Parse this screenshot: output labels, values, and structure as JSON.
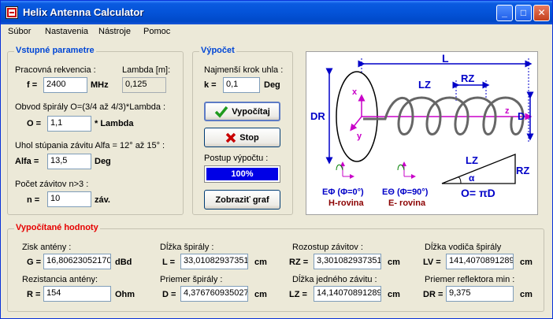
{
  "window": {
    "title": "Helix Antenna Calculator"
  },
  "menu": [
    "Súbor",
    "Nastavenia",
    "Nástroje",
    "Pomoc"
  ],
  "input_group": {
    "title": "Vstupné parametre",
    "freq_label": "Pracovná rekvencia :",
    "lambda_label": "Lambda [m]:",
    "f_symbol": "f =",
    "f_value": "2400",
    "f_unit": "MHz",
    "lambda_value": "0,125",
    "circ_label": "Obvod špirály O=(3/4 až 4/3)*Lambda :",
    "o_symbol": "O =",
    "o_value": "1,1",
    "o_unit": "* Lambda",
    "angle_label": "Uhol stúpania závitu  Alfa = 12° až 15° :",
    "alfa_symbol": "Alfa =",
    "alfa_value": "13,5",
    "alfa_unit": "Deg",
    "turns_label": "Počet závitov n>3 :",
    "n_symbol": "n =",
    "n_value": "10",
    "n_unit": "záv."
  },
  "calc_group": {
    "title": "Výpočet",
    "step_label": "Najmenší krok uhla :",
    "k_symbol": "k =",
    "k_value": "0,1",
    "k_unit": "Deg",
    "calc_button": "Vypočítaj",
    "stop_button": "Stop",
    "progress_label": "Postup výpočtu :",
    "progress_text": "100%",
    "progress_fraction": 1.0,
    "graph_button": "Zobraziť graf"
  },
  "diagram": {
    "L": "L",
    "RZ": "RZ",
    "LZ": "LZ",
    "DR": "DR",
    "D": "D",
    "x": "x",
    "y": "y",
    "z": "z",
    "e_phi": "EΦ (Φ=0°)",
    "e_theta": "EΘ (Φ=90°)",
    "h_plane": "H-rovina",
    "e_plane": "E- rovina",
    "tri_LZ": "LZ",
    "tri_RZ": "RZ",
    "alpha": "α",
    "formula": "O= πD"
  },
  "results": {
    "title": "Vypočítané hodnoty",
    "gain_label": "Zisk antény :",
    "g_symbol": "G =",
    "g_value": "16,80623052170",
    "g_unit": "dBd",
    "spiral_len_label": "Dĺžka špirály :",
    "l_symbol": "L =",
    "l_value": "33,01082937351",
    "l_unit": "cm",
    "spacing_label": "Rozostup závitov :",
    "rz_symbol": "RZ =",
    "rz_value": "3,301082937351",
    "rz_unit": "cm",
    "wire_len_label": "Dĺžka vodiča špirály",
    "lv_symbol": "LV =",
    "lv_value": "141,4070891289",
    "lv_unit": "cm",
    "resistance_label": "Rezistancia antény:",
    "r_symbol": "R =",
    "r_value": "154",
    "r_unit": "Ohm",
    "diameter_label": "Priemer špirály :",
    "d_symbol": "D =",
    "d_value": "4,376760935027",
    "d_unit": "cm",
    "turn_len_label": "Dĺžka jedného závitu :",
    "lz_symbol": "LZ =",
    "lz_value": "14,14070891289",
    "lz_unit": "cm",
    "reflector_label": "Priemer  reflektora min :",
    "dr_symbol": "DR =",
    "dr_value": "9,375",
    "dr_unit": "cm"
  },
  "colors": {
    "group_title": "#0046d5",
    "results_title": "#e60000",
    "diagram_blue": "#0000c8",
    "diagram_magenta": "#c800c8",
    "diagram_darkred": "#8b0000"
  }
}
